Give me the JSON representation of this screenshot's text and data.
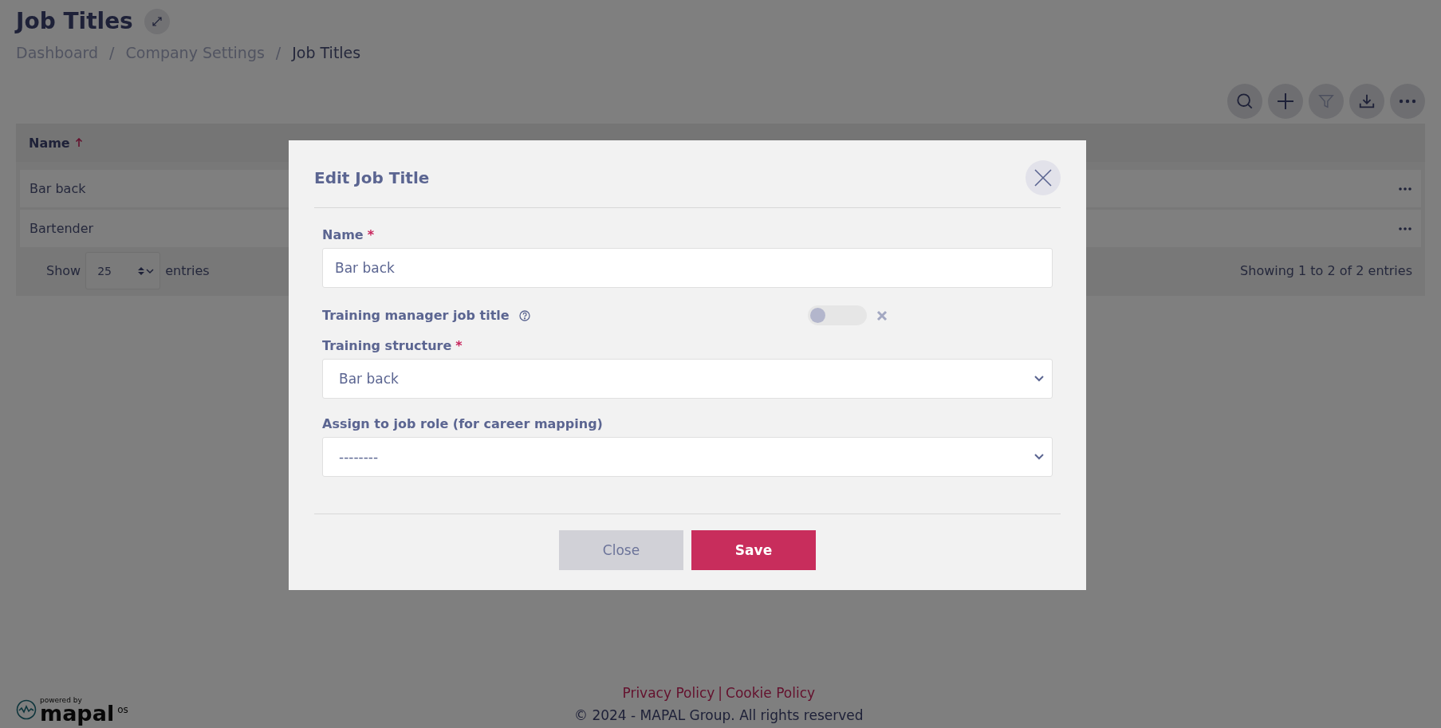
{
  "page": {
    "title": "Job Titles",
    "breadcrumb_separator": "/",
    "breadcrumb": [
      {
        "label": "Dashboard",
        "current": false
      },
      {
        "label": "Company Settings",
        "current": false
      },
      {
        "label": "Job Titles",
        "current": true
      }
    ]
  },
  "toolbar": {
    "buttons": [
      {
        "kind": "search",
        "disabled": false
      },
      {
        "kind": "add",
        "disabled": false
      },
      {
        "kind": "filter",
        "disabled": true
      },
      {
        "kind": "download",
        "disabled": false
      },
      {
        "kind": "more",
        "disabled": false
      }
    ]
  },
  "table": {
    "columns": [
      {
        "label": "Name",
        "sorted_ascending": true
      }
    ],
    "rows": [
      {
        "name": "Bar back"
      },
      {
        "name": "Bartender"
      }
    ],
    "page_size": "25",
    "show_label": "Show",
    "entries_label": "entries",
    "info": "Showing 1 to 2 of 2 entries"
  },
  "modal": {
    "title": "Edit Job Title",
    "required_mark": "*",
    "fields": [
      {
        "kind": "text",
        "label": "Name",
        "required": true,
        "value": "Bar back"
      },
      {
        "kind": "toggle",
        "label": "Training manager job title",
        "help": true,
        "on": false
      },
      {
        "kind": "select",
        "label": "Training structure",
        "required": true,
        "value": "Bar back"
      },
      {
        "kind": "select",
        "label": "Assign to job role (for career mapping)",
        "required": false,
        "value": "--------"
      }
    ],
    "buttons": [
      {
        "label": "Close",
        "kind": "secondary"
      },
      {
        "label": "Save",
        "kind": "primary"
      }
    ]
  },
  "footer": {
    "logo": {
      "caption": "powered by",
      "name": "mapal",
      "suffix": "os"
    },
    "links": [
      "Privacy Policy",
      "Cookie Policy"
    ],
    "separator": "|",
    "copyright": "© 2024 - MAPAL Group. All rights reserved"
  }
}
